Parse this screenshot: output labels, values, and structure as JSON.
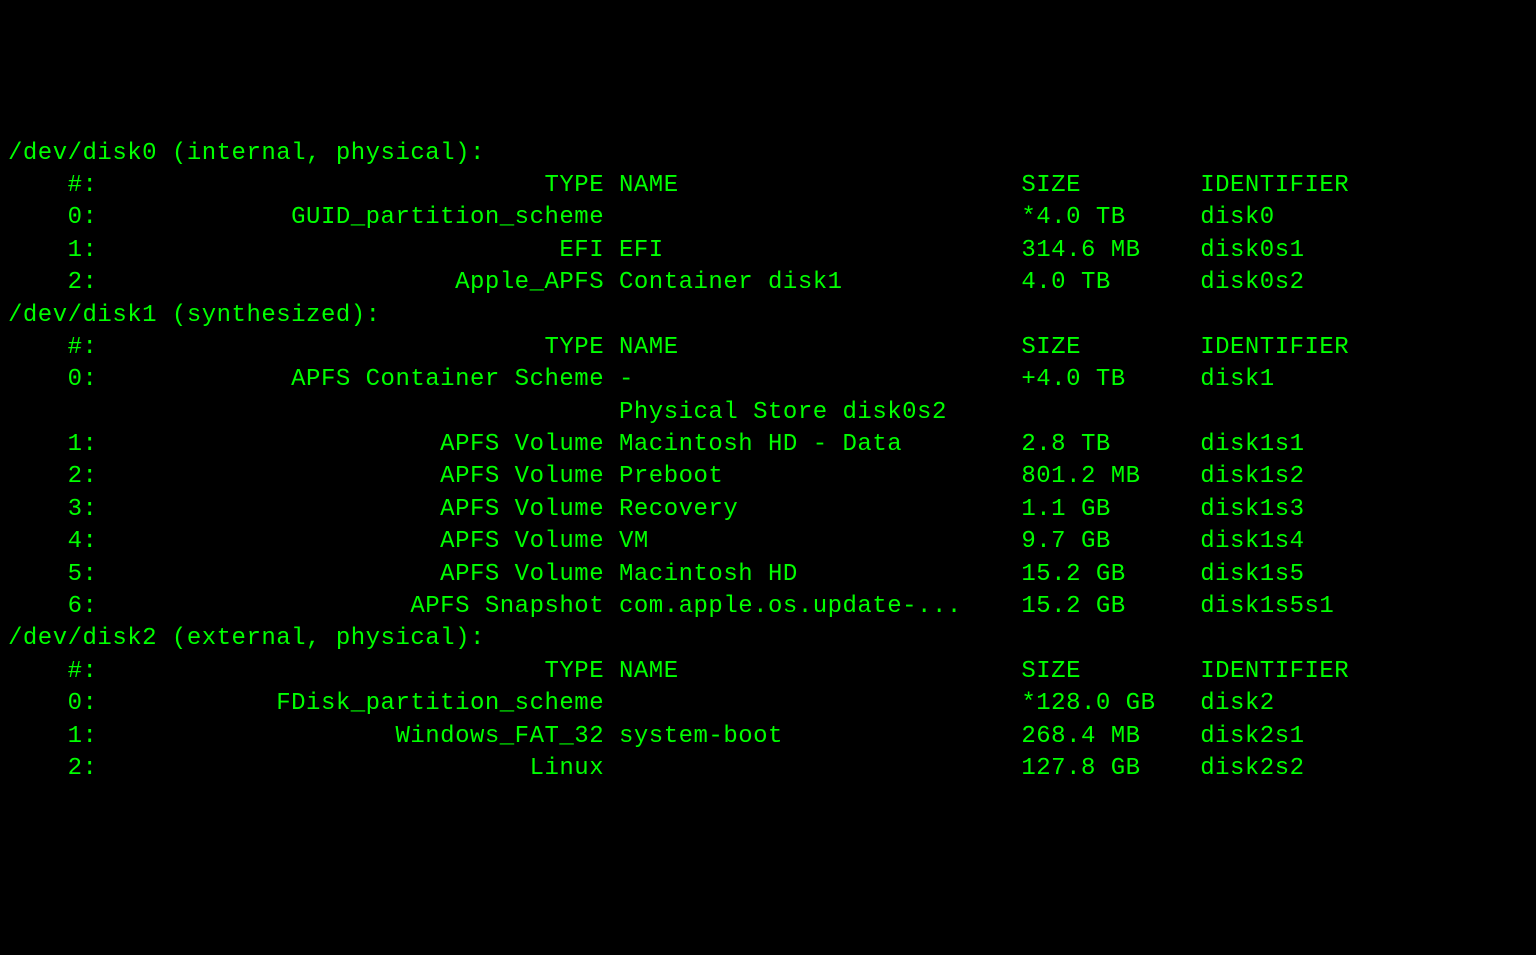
{
  "colors": {
    "fg": "#00ff00",
    "bg": "#000000"
  },
  "col": {
    "num_w": 6,
    "type_w": 33,
    "name_w": 27,
    "size_w": 12,
    "id_w": 12
  },
  "hdr": {
    "num": "#:",
    "type": "TYPE",
    "name": "NAME",
    "size": "SIZE",
    "id": "IDENTIFIER"
  },
  "disks": [
    {
      "dev": "/dev/disk0",
      "attrs": "(internal, physical):",
      "rows": [
        {
          "num": "0:",
          "type": "GUID_partition_scheme",
          "name": "",
          "size": "*4.0 TB",
          "id": "disk0"
        },
        {
          "num": "1:",
          "type": "EFI",
          "name": "EFI",
          "size": "314.6 MB",
          "id": "disk0s1"
        },
        {
          "num": "2:",
          "type": "Apple_APFS",
          "name": "Container disk1",
          "size": "4.0 TB",
          "id": "disk0s2"
        }
      ]
    },
    {
      "dev": "/dev/disk1",
      "attrs": "(synthesized):",
      "rows": [
        {
          "num": "0:",
          "type": "APFS Container Scheme",
          "name": "-",
          "size": "+4.0 TB",
          "id": "disk1"
        },
        {
          "num": "",
          "type": "",
          "name": "Physical Store disk0s2",
          "size": "",
          "id": ""
        },
        {
          "num": "1:",
          "type": "APFS Volume",
          "name": "Macintosh HD - Data",
          "size": "2.8 TB",
          "id": "disk1s1"
        },
        {
          "num": "2:",
          "type": "APFS Volume",
          "name": "Preboot",
          "size": "801.2 MB",
          "id": "disk1s2"
        },
        {
          "num": "3:",
          "type": "APFS Volume",
          "name": "Recovery",
          "size": "1.1 GB",
          "id": "disk1s3"
        },
        {
          "num": "4:",
          "type": "APFS Volume",
          "name": "VM",
          "size": "9.7 GB",
          "id": "disk1s4"
        },
        {
          "num": "5:",
          "type": "APFS Volume",
          "name": "Macintosh HD",
          "size": "15.2 GB",
          "id": "disk1s5"
        },
        {
          "num": "6:",
          "type": "APFS Snapshot",
          "name": "com.apple.os.update-...",
          "size": "15.2 GB",
          "id": "disk1s5s1"
        }
      ]
    },
    {
      "dev": "/dev/disk2",
      "attrs": "(external, physical):",
      "rows": [
        {
          "num": "0:",
          "type": "FDisk_partition_scheme",
          "name": "",
          "size": "*128.0 GB",
          "id": "disk2"
        },
        {
          "num": "1:",
          "type": "Windows_FAT_32",
          "name": "system-boot",
          "size": "268.4 MB",
          "id": "disk2s1"
        },
        {
          "num": "2:",
          "type": "Linux",
          "name": "",
          "size": "127.8 GB",
          "id": "disk2s2"
        }
      ]
    }
  ]
}
